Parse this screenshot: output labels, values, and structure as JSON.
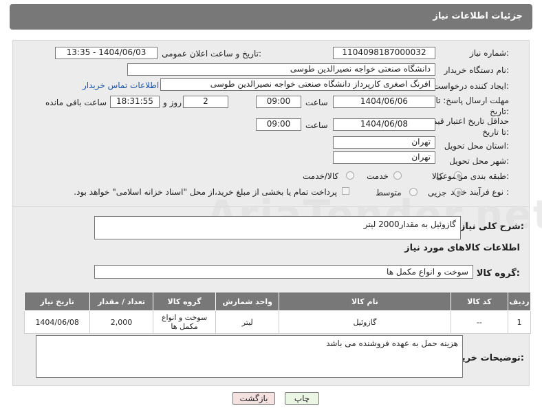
{
  "header": {
    "title": "جزئیات اطلاعات نیاز"
  },
  "fields": {
    "need_number_label": "شماره نیاز:",
    "need_number": "1104098187000032",
    "announce_label": "تاریخ و ساعت اعلان عمومی:",
    "announce_value": "1404/06/03 - 13:35",
    "buyer_label": "نام دستگاه خریدار:",
    "buyer_value": "دانشگاه صنعتی خواجه نصیرالدین طوسی",
    "creator_label": "ایجاد کننده درخواست:",
    "creator_value": "افرنگ اصغری کارپرداز دانشگاه صنعتی خواجه نصیرالدین طوسی",
    "contact_link": "اطلاعات تماس خریدار",
    "deadline_label": "مهلت ارسال پاسخ: تا تاریخ:",
    "deadline_date": "1404/06/06",
    "time_label": "ساعت",
    "deadline_time": "09:00",
    "days_value": "2",
    "days_label": "روز و",
    "remaining_value": "18:31:55",
    "remaining_label": "ساعت باقی مانده",
    "validity_label": "حداقل تاریخ اعتبار قیمت: تا تاریخ:",
    "validity_date": "1404/06/08",
    "validity_time": "09:00",
    "province_label": "استان محل تحویل:",
    "province_value": "تهران",
    "city_label": "شهر محل تحویل:",
    "city_value": "تهران",
    "category_label": "طبقه بندی موضوعی:",
    "category_options": [
      "کالا",
      "خدمت",
      "کالا/خدمت"
    ],
    "category_selected": "کالا",
    "process_label": "نوع فرآیند خرید :",
    "process_options": [
      "جزیی",
      "متوسط"
    ],
    "payment_note": "پرداخت تمام یا بخشی از مبلغ خرید،از محل \"اسناد خزانه اسلامی\" خواهد بود.",
    "description_label": "شرح کلی نیاز:",
    "description_value": "گازوئیل به مقدار2000 لیتر",
    "goods_info_title": "اطلاعات کالاهای مورد نیاز",
    "goods_group_label": "گروه کالا:",
    "goods_group_value": "سوخت و انواع مکمل ها"
  },
  "table": {
    "headers": [
      "ردیف",
      "کد کالا",
      "نام کالا",
      "واحد شمارش",
      "گروه کالا",
      "تعداد / مقدار",
      "تاریخ نیاز"
    ],
    "rows": [
      [
        "1",
        "--",
        "گازوئیل",
        "لیتر",
        "سوخت و انواع مکمل ها",
        "2,000",
        "1404/06/08"
      ]
    ]
  },
  "buyer_notes_label": "توضیحات خریدار:",
  "buyer_notes_value": "هزینه حمل به عهده فروشنده می باشد",
  "buttons": {
    "print": "چاپ",
    "back": "بازگشت"
  },
  "watermark": "AriaTender.net"
}
